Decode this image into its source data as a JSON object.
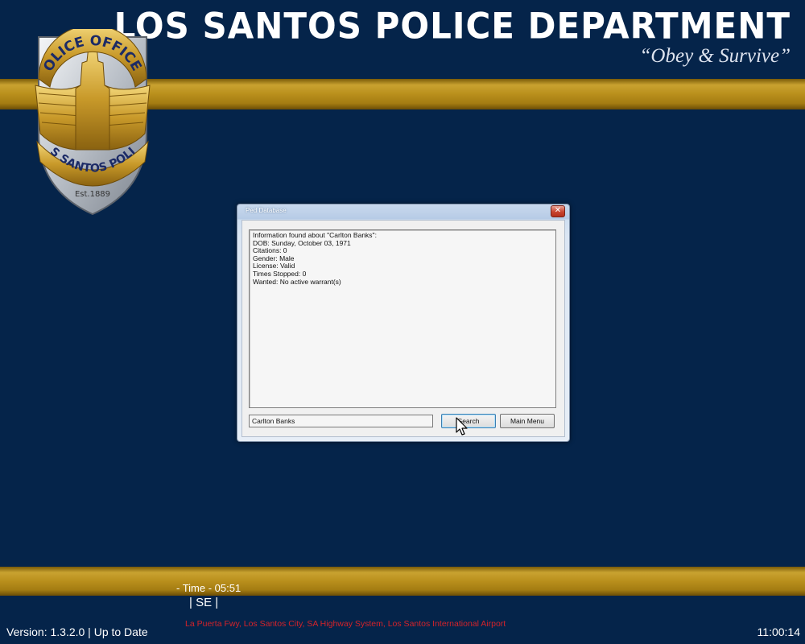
{
  "header": {
    "title": "LOS SANTOS POLICE DEPARTMENT",
    "motto": "“Obey & Survive”"
  },
  "badge": {
    "top_text": "POLICE OFFICER",
    "bottom_text": "LOS SANTOS POLICE",
    "est": "Est.1889"
  },
  "dialog": {
    "title": "Ped Database",
    "close_label": "✕",
    "output_lines": [
      "Information found about \"Carlton Banks\":",
      "DOB: Sunday, October 03, 1971",
      "Citations: 0",
      "Gender: Male",
      "License: Valid",
      "Times Stopped: 0",
      "Wanted: No active warrant(s)"
    ],
    "search_value": "Carlton Banks",
    "search_button": "Search",
    "menu_button": "Main Menu"
  },
  "footer": {
    "time": "- Time - 05:51",
    "heading": "| SE |",
    "location": "La Puerta Fwy, Los Santos City, SA Highway System, Los Santos International Airport",
    "version": "Version: 1.3.2.0 | Up to Date",
    "clock": "11:00:14"
  },
  "colors": {
    "background": "#05244a",
    "gold": "#b98f1c",
    "location_text": "#d4232a"
  }
}
